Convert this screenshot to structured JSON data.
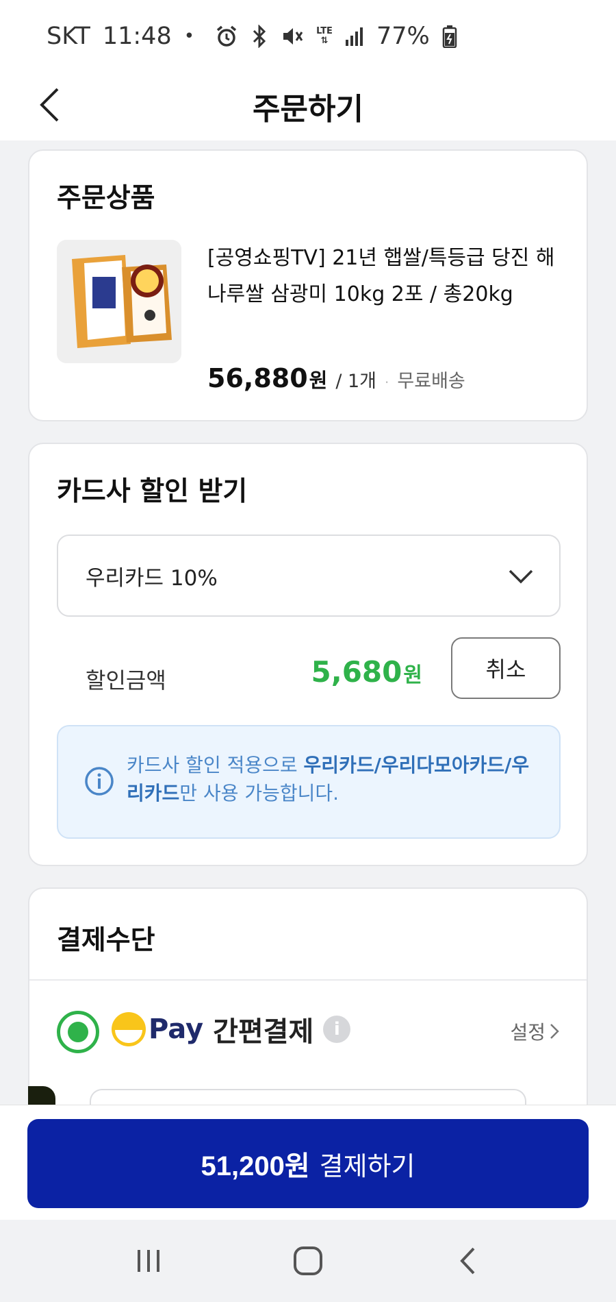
{
  "status_bar": {
    "carrier": "SKT",
    "time": "11:48",
    "dot": "•",
    "network": "LTE",
    "battery": "77%"
  },
  "header": {
    "title": "주문하기",
    "back_icon": "back-arrow-icon"
  },
  "order_product": {
    "section_title": "주문상품",
    "thumbnail_icon": "rice-bag-image",
    "name": "[공영쇼핑TV] 21년 햅쌀/특등급 당진 해나루쌀 삼광미 10kg 2포 / 총20kg",
    "price": "56,880",
    "price_unit": "원",
    "quantity": "/ 1개",
    "separator": "·",
    "shipping": "무료배송"
  },
  "card_discount": {
    "section_title": "카드사 할인 받기",
    "selected_card": "우리카드 10%",
    "discount_label": "할인금액",
    "discount_amount": "5,680",
    "discount_unit": "원",
    "cancel_label": "취소",
    "info_plain": "카드사 할인 적용으로 ",
    "info_bold": "우리카드/우리다모아카드/우리카드",
    "info_tail": "만 사용 가능합니다.",
    "info_icon": "info-icon",
    "accent_color": "#2fb24a"
  },
  "payment_method": {
    "section_title": "결제수단",
    "pay_brand": "Pay",
    "pay_title": "간편결제",
    "help_icon": "help-icon",
    "settings_label": "설정"
  },
  "pay_button": {
    "amount": "51,200원",
    "action": "결제하기",
    "color": "#0b22a4"
  },
  "nav_bar": {
    "recent_icon": "recent-apps-icon",
    "home_icon": "home-icon",
    "back_icon": "nav-back-icon"
  }
}
